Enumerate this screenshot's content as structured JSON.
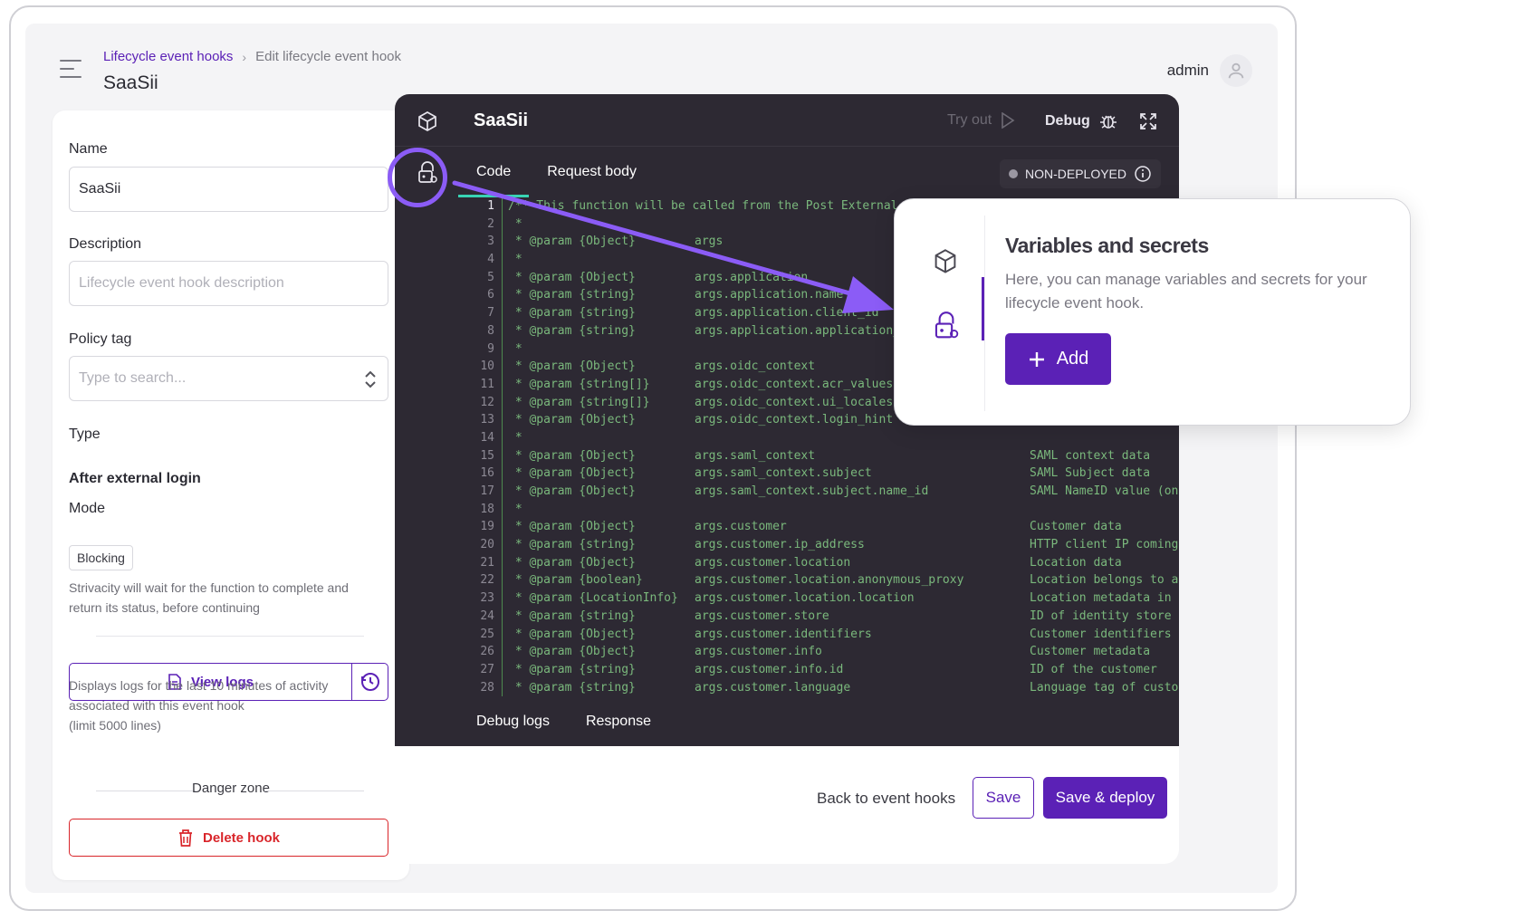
{
  "header": {
    "breadcrumb_link": "Lifecycle event hooks",
    "breadcrumb_current": "Edit lifecycle event hook",
    "page_title": "SaaSii",
    "user_name": "admin"
  },
  "form": {
    "name_label": "Name",
    "name_value": "SaaSii",
    "description_label": "Description",
    "description_placeholder": "Lifecycle event hook description",
    "policy_label": "Policy tag",
    "policy_placeholder": "Type to search...",
    "type_label": "Type",
    "type_value": "After external login",
    "mode_label": "Mode",
    "mode_value": "Blocking",
    "mode_help_1": "Strivacity will wait for the function to complete and",
    "mode_help_2": "return its status, before continuing",
    "view_logs_label": "View logs",
    "logs_help_1": "Displays logs for the last 10 minutes of activity",
    "logs_help_2": "associated with this event hook",
    "logs_help_3": "(limit 5000 lines)",
    "danger_zone_label": "Danger zone",
    "delete_label": "Delete hook"
  },
  "editor": {
    "title": "SaaSii",
    "try_out_label": "Try out",
    "debug_label": "Debug",
    "tabs": [
      "Code",
      "Request body"
    ],
    "status_label": "NON-DEPLOYED",
    "bottom_tabs": [
      "Debug logs",
      "Response"
    ],
    "code_lines": [
      {
        "n": "1",
        "a": "/** This function will be called from the Post External L",
        "b": "",
        "c": ""
      },
      {
        "n": "2",
        "a": " *",
        "b": "",
        "c": ""
      },
      {
        "n": "3",
        "a": " * @param {Object}",
        "b": "args",
        "c": ""
      },
      {
        "n": "4",
        "a": " *",
        "b": "",
        "c": ""
      },
      {
        "n": "5",
        "a": " * @param {Object}",
        "b": "args.application",
        "c": ""
      },
      {
        "n": "6",
        "a": " * @param {string}",
        "b": "args.application.name",
        "c": ""
      },
      {
        "n": "7",
        "a": " * @param {string}",
        "b": "args.application.client_id",
        "c": ""
      },
      {
        "n": "8",
        "a": " * @param {string}",
        "b": "args.application.application_",
        "c": ""
      },
      {
        "n": "9",
        "a": " *",
        "b": "",
        "c": ""
      },
      {
        "n": "10",
        "a": " * @param {Object}",
        "b": "args.oidc_context",
        "c": ""
      },
      {
        "n": "11",
        "a": " * @param {string[]}",
        "b": "args.oidc_context.acr_values",
        "c": ""
      },
      {
        "n": "12",
        "a": " * @param {string[]}",
        "b": "args.oidc_context.ui_locales",
        "c": ""
      },
      {
        "n": "13",
        "a": " * @param {Object}",
        "b": "args.oidc_context.login_hint",
        "c": ""
      },
      {
        "n": "14",
        "a": " *",
        "b": "",
        "c": ""
      },
      {
        "n": "15",
        "a": " * @param {Object}",
        "b": "args.saml_context",
        "c": "SAML context data"
      },
      {
        "n": "16",
        "a": " * @param {Object}",
        "b": "args.saml_context.subject",
        "c": "SAML Subject data"
      },
      {
        "n": "17",
        "a": " * @param {Object}",
        "b": "args.saml_context.subject.name_id",
        "c": "SAML NameID value (on"
      },
      {
        "n": "18",
        "a": " *",
        "b": "",
        "c": ""
      },
      {
        "n": "19",
        "a": " * @param {Object}",
        "b": "args.customer",
        "c": "Customer data"
      },
      {
        "n": "20",
        "a": " * @param {string}",
        "b": "args.customer.ip_address",
        "c": "HTTP client IP coming"
      },
      {
        "n": "21",
        "a": " * @param {Object}",
        "b": "args.customer.location",
        "c": "Location data"
      },
      {
        "n": "22",
        "a": " * @param {boolean}",
        "b": "args.customer.location.anonymous_proxy",
        "c": "Location belongs to a"
      },
      {
        "n": "23",
        "a": " * @param {LocationInfo}",
        "b": "args.customer.location.location",
        "c": "Location metadata in"
      },
      {
        "n": "24",
        "a": " * @param {string}",
        "b": "args.customer.store",
        "c": "ID of identity store"
      },
      {
        "n": "25",
        "a": " * @param {Object}",
        "b": "args.customer.identifiers",
        "c": "Customer identifiers"
      },
      {
        "n": "26",
        "a": " * @param {Object}",
        "b": "args.customer.info",
        "c": "Customer metadata"
      },
      {
        "n": "27",
        "a": " * @param {string}",
        "b": "args.customer.info.id",
        "c": "ID of the customer"
      },
      {
        "n": "28",
        "a": " * @param {string}",
        "b": "args.customer.language",
        "c": "Language tag of custo"
      }
    ]
  },
  "footer": {
    "back_label": "Back to event hooks",
    "save_label": "Save",
    "deploy_label": "Save & deploy"
  },
  "callout": {
    "title": "Variables and secrets",
    "description": "Here, you can manage variables and secrets for your lifecycle event hook.",
    "add_label": "Add"
  },
  "colors": {
    "accent": "#5b21b6",
    "highlight": "#8b5cf6",
    "danger": "#d9252a",
    "editor_bg": "#2d2933",
    "code_comment": "#7ab87c",
    "tab_active": "#38d3b4"
  }
}
